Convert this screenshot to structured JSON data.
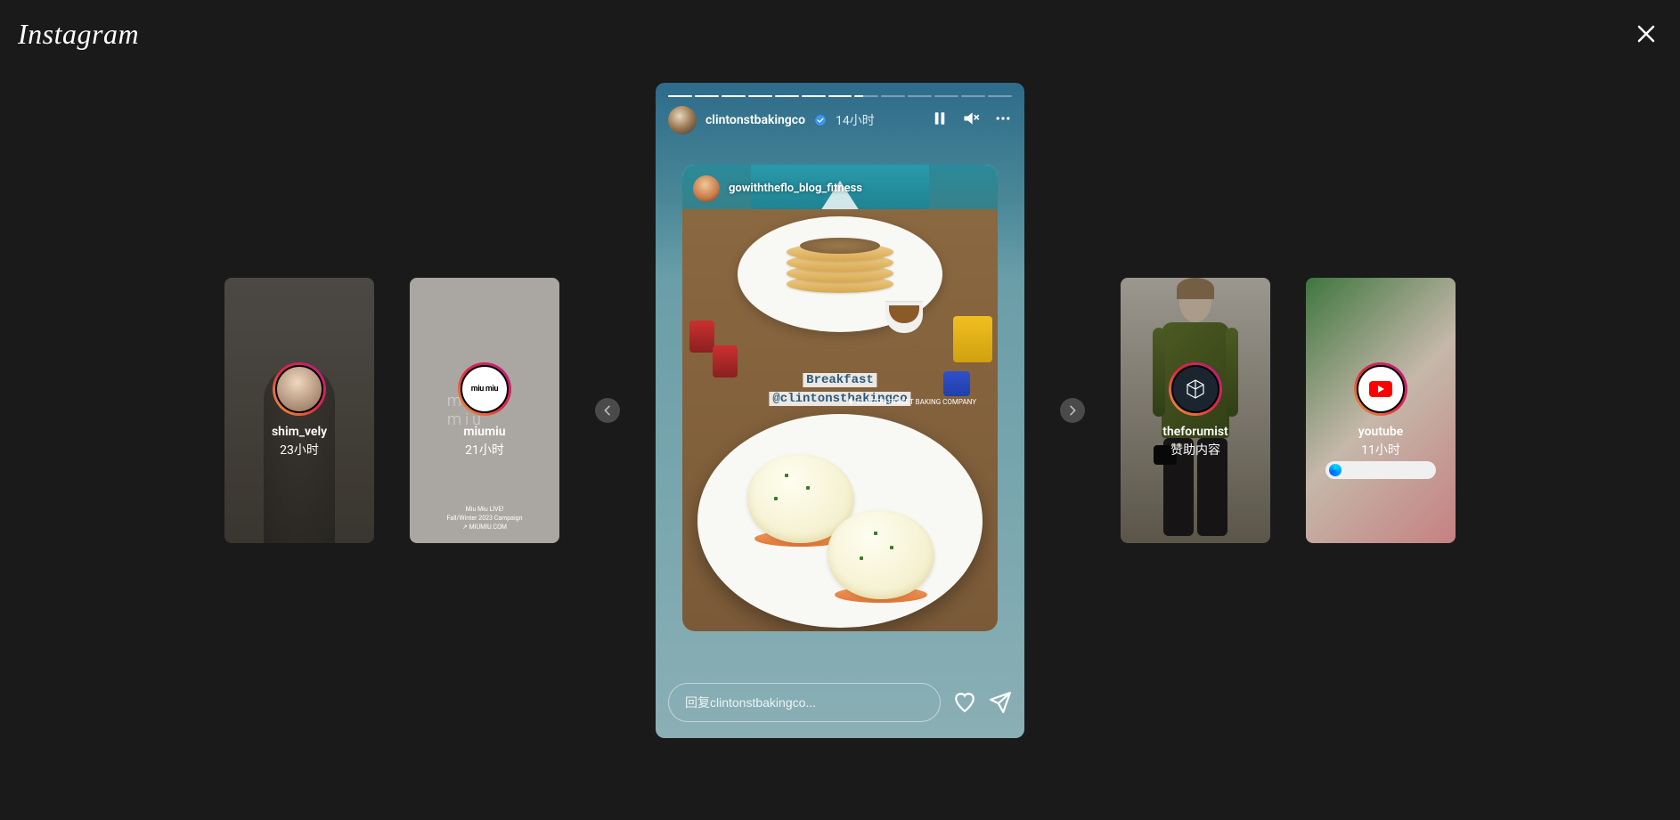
{
  "brand": "Instagram",
  "side_stories": {
    "left": [
      {
        "username": "shim_vely",
        "time": "23小时",
        "avatar_label": ""
      },
      {
        "username": "miumiu",
        "time": "21小时",
        "avatar_label": "miu miu",
        "watermark": "miu miu",
        "foot1": "Miu Miu LIVE!",
        "foot2": "Fall/Winter 2023 Campaign",
        "foot3": "↗ MIUMIU.COM"
      }
    ],
    "right": [
      {
        "username": "theforumist",
        "time": "赞助内容"
      },
      {
        "username": "youtube",
        "time": "11小时"
      }
    ]
  },
  "main_story": {
    "username": "clintonstbakingco",
    "time": "14小时",
    "progress": {
      "total": 13,
      "done": 7
    },
    "repost": {
      "username": "gowiththeflo_blog_fitness",
      "tag_line1": "Breakfast",
      "tag_line2": "@clintonstbakingco",
      "location": "CLINTON STREET BAKING COMPANY"
    },
    "reply_placeholder": "回复clintonstbakingco..."
  }
}
